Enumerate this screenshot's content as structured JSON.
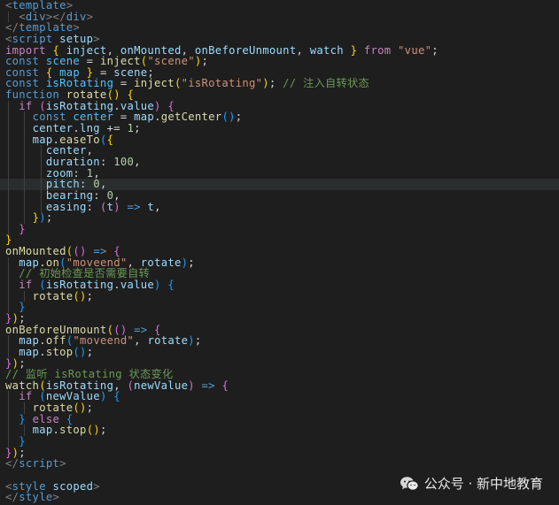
{
  "editor": {
    "background": "#1e1e1e",
    "lines": [
      {
        "indent": 0,
        "tokens": [
          [
            "br",
            "<"
          ],
          [
            "tag",
            "template"
          ],
          [
            "br",
            ">"
          ]
        ]
      },
      {
        "indent": 1,
        "tokens": [
          [
            "op",
            "  "
          ],
          [
            "br",
            "<"
          ],
          [
            "tag",
            "div"
          ],
          [
            "br",
            "></"
          ],
          [
            "tag",
            "div"
          ],
          [
            "br",
            ">"
          ]
        ]
      },
      {
        "indent": 0,
        "tokens": [
          [
            "br",
            "</"
          ],
          [
            "tag",
            "template"
          ],
          [
            "br",
            ">"
          ]
        ]
      },
      {
        "indent": 0,
        "tokens": [
          [
            "br",
            "<"
          ],
          [
            "tag",
            "script"
          ],
          [
            "op",
            " "
          ],
          [
            "attr",
            "setup"
          ],
          [
            "br",
            ">"
          ]
        ]
      },
      {
        "indent": 0,
        "tokens": [
          [
            "ctl",
            "import"
          ],
          [
            "op",
            " "
          ],
          [
            "p1",
            "{"
          ],
          [
            "op",
            " "
          ],
          [
            "prop",
            "inject"
          ],
          [
            "op",
            ", "
          ],
          [
            "prop",
            "onMounted"
          ],
          [
            "op",
            ", "
          ],
          [
            "prop",
            "onBeforeUnmount"
          ],
          [
            "op",
            ", "
          ],
          [
            "prop",
            "watch"
          ],
          [
            "op",
            " "
          ],
          [
            "p1",
            "}"
          ],
          [
            "op",
            " "
          ],
          [
            "ctl",
            "from"
          ],
          [
            "op",
            " "
          ],
          [
            "str",
            "\"vue\""
          ],
          [
            "op",
            ";"
          ]
        ]
      },
      {
        "indent": 0,
        "tokens": [
          [
            "kw",
            "const"
          ],
          [
            "op",
            " "
          ],
          [
            "var",
            "scene"
          ],
          [
            "op",
            " = "
          ],
          [
            "fn",
            "inject"
          ],
          [
            "p1",
            "("
          ],
          [
            "str",
            "\"scene\""
          ],
          [
            "p1",
            ")"
          ],
          [
            "op",
            ";"
          ]
        ]
      },
      {
        "indent": 0,
        "tokens": [
          [
            "kw",
            "const"
          ],
          [
            "op",
            " "
          ],
          [
            "p1",
            "{"
          ],
          [
            "op",
            " "
          ],
          [
            "var",
            "map"
          ],
          [
            "op",
            " "
          ],
          [
            "p1",
            "}"
          ],
          [
            "op",
            " = "
          ],
          [
            "prop",
            "scene"
          ],
          [
            "op",
            ";"
          ]
        ]
      },
      {
        "indent": 0,
        "tokens": [
          [
            "kw",
            "const"
          ],
          [
            "op",
            " "
          ],
          [
            "var",
            "isRotating"
          ],
          [
            "op",
            " = "
          ],
          [
            "fn",
            "inject"
          ],
          [
            "p1",
            "("
          ],
          [
            "str",
            "\"isRotating\""
          ],
          [
            "p1",
            ")"
          ],
          [
            "op",
            "; "
          ],
          [
            "cmt",
            "// 注入自转状态"
          ]
        ]
      },
      {
        "indent": 0,
        "tokens": [
          [
            "kw",
            "function"
          ],
          [
            "op",
            " "
          ],
          [
            "fn",
            "rotate"
          ],
          [
            "p1",
            "()"
          ],
          [
            "op",
            " "
          ],
          [
            "p1",
            "{"
          ]
        ]
      },
      {
        "indent": 1,
        "tokens": [
          [
            "op",
            "  "
          ],
          [
            "ctl",
            "if"
          ],
          [
            "op",
            " "
          ],
          [
            "p2",
            "("
          ],
          [
            "prop",
            "isRotating"
          ],
          [
            "op",
            "."
          ],
          [
            "prop",
            "value"
          ],
          [
            "p2",
            ")"
          ],
          [
            "op",
            " "
          ],
          [
            "p2",
            "{"
          ]
        ]
      },
      {
        "indent": 2,
        "tokens": [
          [
            "op",
            "    "
          ],
          [
            "kw",
            "const"
          ],
          [
            "op",
            " "
          ],
          [
            "var",
            "center"
          ],
          [
            "op",
            " = "
          ],
          [
            "prop",
            "map"
          ],
          [
            "op",
            "."
          ],
          [
            "fn",
            "getCenter"
          ],
          [
            "p3",
            "()"
          ],
          [
            "op",
            ";"
          ]
        ]
      },
      {
        "indent": 2,
        "tokens": [
          [
            "op",
            "    "
          ],
          [
            "prop",
            "center"
          ],
          [
            "op",
            "."
          ],
          [
            "prop",
            "lng"
          ],
          [
            "op",
            " += "
          ],
          [
            "num",
            "1"
          ],
          [
            "op",
            ";"
          ]
        ]
      },
      {
        "indent": 2,
        "tokens": [
          [
            "op",
            "    "
          ],
          [
            "prop",
            "map"
          ],
          [
            "op",
            "."
          ],
          [
            "fn",
            "easeTo"
          ],
          [
            "p3",
            "("
          ],
          [
            "p1",
            "{"
          ]
        ]
      },
      {
        "indent": 3,
        "tokens": [
          [
            "op",
            "      "
          ],
          [
            "prop",
            "center"
          ],
          [
            "op",
            ","
          ]
        ]
      },
      {
        "indent": 3,
        "tokens": [
          [
            "op",
            "      "
          ],
          [
            "prop",
            "duration"
          ],
          [
            "op",
            ": "
          ],
          [
            "num",
            "100"
          ],
          [
            "op",
            ","
          ]
        ]
      },
      {
        "indent": 3,
        "tokens": [
          [
            "op",
            "      "
          ],
          [
            "prop",
            "zoom"
          ],
          [
            "op",
            ": "
          ],
          [
            "num",
            "1"
          ],
          [
            "op",
            ","
          ]
        ]
      },
      {
        "indent": 3,
        "tokens": [
          [
            "op",
            "      "
          ],
          [
            "prop",
            "pitch"
          ],
          [
            "op",
            ": "
          ],
          [
            "num",
            "0"
          ],
          [
            "op",
            ","
          ]
        ],
        "highlight": true
      },
      {
        "indent": 3,
        "tokens": [
          [
            "op",
            "      "
          ],
          [
            "prop",
            "bearing"
          ],
          [
            "op",
            ": "
          ],
          [
            "num",
            "0"
          ],
          [
            "op",
            ","
          ]
        ]
      },
      {
        "indent": 3,
        "tokens": [
          [
            "op",
            "      "
          ],
          [
            "prop",
            "easing"
          ],
          [
            "op",
            ": "
          ],
          [
            "p2",
            "("
          ],
          [
            "prop",
            "t"
          ],
          [
            "p2",
            ")"
          ],
          [
            "op",
            " "
          ],
          [
            "kw",
            "=>"
          ],
          [
            "op",
            " "
          ],
          [
            "prop",
            "t"
          ],
          [
            "op",
            ","
          ]
        ]
      },
      {
        "indent": 2,
        "tokens": [
          [
            "op",
            "    "
          ],
          [
            "p1",
            "}"
          ],
          [
            "p3",
            ")"
          ],
          [
            "op",
            ";"
          ]
        ]
      },
      {
        "indent": 1,
        "tokens": [
          [
            "op",
            "  "
          ],
          [
            "p2",
            "}"
          ]
        ]
      },
      {
        "indent": 0,
        "tokens": [
          [
            "p1",
            "}"
          ]
        ]
      },
      {
        "indent": 0,
        "tokens": [
          [
            "fn",
            "onMounted"
          ],
          [
            "p1",
            "("
          ],
          [
            "p2",
            "()"
          ],
          [
            "op",
            " "
          ],
          [
            "kw",
            "=>"
          ],
          [
            "op",
            " "
          ],
          [
            "p2",
            "{"
          ]
        ]
      },
      {
        "indent": 1,
        "tokens": [
          [
            "op",
            "  "
          ],
          [
            "prop",
            "map"
          ],
          [
            "op",
            "."
          ],
          [
            "fn",
            "on"
          ],
          [
            "p3",
            "("
          ],
          [
            "str",
            "\"moveend\""
          ],
          [
            "op",
            ", "
          ],
          [
            "prop",
            "rotate"
          ],
          [
            "p3",
            ")"
          ],
          [
            "op",
            ";"
          ]
        ]
      },
      {
        "indent": 1,
        "tokens": [
          [
            "op",
            "  "
          ],
          [
            "cmt",
            "// 初始检查是否需要自转"
          ]
        ]
      },
      {
        "indent": 1,
        "tokens": [
          [
            "op",
            "  "
          ],
          [
            "ctl",
            "if"
          ],
          [
            "op",
            " "
          ],
          [
            "p3",
            "("
          ],
          [
            "prop",
            "isRotating"
          ],
          [
            "op",
            "."
          ],
          [
            "prop",
            "value"
          ],
          [
            "p3",
            ")"
          ],
          [
            "op",
            " "
          ],
          [
            "p3",
            "{"
          ]
        ]
      },
      {
        "indent": 2,
        "tokens": [
          [
            "op",
            "    "
          ],
          [
            "fn",
            "rotate"
          ],
          [
            "p1",
            "()"
          ],
          [
            "op",
            ";"
          ]
        ]
      },
      {
        "indent": 1,
        "tokens": [
          [
            "op",
            "  "
          ],
          [
            "p3",
            "}"
          ]
        ]
      },
      {
        "indent": 0,
        "tokens": [
          [
            "p2",
            "}"
          ],
          [
            "p1",
            ")"
          ],
          [
            "op",
            ";"
          ]
        ]
      },
      {
        "indent": 0,
        "tokens": [
          [
            "fn",
            "onBeforeUnmount"
          ],
          [
            "p1",
            "("
          ],
          [
            "p2",
            "()"
          ],
          [
            "op",
            " "
          ],
          [
            "kw",
            "=>"
          ],
          [
            "op",
            " "
          ],
          [
            "p2",
            "{"
          ]
        ]
      },
      {
        "indent": 1,
        "tokens": [
          [
            "op",
            "  "
          ],
          [
            "prop",
            "map"
          ],
          [
            "op",
            "."
          ],
          [
            "fn",
            "off"
          ],
          [
            "p3",
            "("
          ],
          [
            "str",
            "\"moveend\""
          ],
          [
            "op",
            ", "
          ],
          [
            "prop",
            "rotate"
          ],
          [
            "p3",
            ")"
          ],
          [
            "op",
            ";"
          ]
        ]
      },
      {
        "indent": 1,
        "tokens": [
          [
            "op",
            "  "
          ],
          [
            "prop",
            "map"
          ],
          [
            "op",
            "."
          ],
          [
            "fn",
            "stop"
          ],
          [
            "p3",
            "()"
          ],
          [
            "op",
            ";"
          ]
        ]
      },
      {
        "indent": 0,
        "tokens": [
          [
            "p2",
            "}"
          ],
          [
            "p1",
            ")"
          ],
          [
            "op",
            ";"
          ]
        ]
      },
      {
        "indent": 0,
        "tokens": [
          [
            "cmt",
            "// 监听 isRotating 状态变化"
          ]
        ]
      },
      {
        "indent": 0,
        "tokens": [
          [
            "fn",
            "watch"
          ],
          [
            "p1",
            "("
          ],
          [
            "prop",
            "isRotating"
          ],
          [
            "op",
            ", "
          ],
          [
            "p2",
            "("
          ],
          [
            "prop",
            "newValue"
          ],
          [
            "p2",
            ")"
          ],
          [
            "op",
            " "
          ],
          [
            "kw",
            "=>"
          ],
          [
            "op",
            " "
          ],
          [
            "p2",
            "{"
          ]
        ]
      },
      {
        "indent": 1,
        "tokens": [
          [
            "op",
            "  "
          ],
          [
            "ctl",
            "if"
          ],
          [
            "op",
            " "
          ],
          [
            "p3",
            "("
          ],
          [
            "prop",
            "newValue"
          ],
          [
            "p3",
            ")"
          ],
          [
            "op",
            " "
          ],
          [
            "p3",
            "{"
          ]
        ]
      },
      {
        "indent": 2,
        "tokens": [
          [
            "op",
            "    "
          ],
          [
            "fn",
            "rotate"
          ],
          [
            "p1",
            "()"
          ],
          [
            "op",
            ";"
          ]
        ]
      },
      {
        "indent": 1,
        "tokens": [
          [
            "op",
            "  "
          ],
          [
            "p3",
            "}"
          ],
          [
            "op",
            " "
          ],
          [
            "ctl",
            "else"
          ],
          [
            "op",
            " "
          ],
          [
            "p3",
            "{"
          ]
        ]
      },
      {
        "indent": 2,
        "tokens": [
          [
            "op",
            "    "
          ],
          [
            "prop",
            "map"
          ],
          [
            "op",
            "."
          ],
          [
            "fn",
            "stop"
          ],
          [
            "p1",
            "()"
          ],
          [
            "op",
            ";"
          ]
        ]
      },
      {
        "indent": 1,
        "tokens": [
          [
            "op",
            "  "
          ],
          [
            "p3",
            "}"
          ]
        ]
      },
      {
        "indent": 0,
        "tokens": [
          [
            "p2",
            "}"
          ],
          [
            "p1",
            ")"
          ],
          [
            "op",
            ";"
          ]
        ]
      },
      {
        "indent": 0,
        "tokens": [
          [
            "br",
            "</"
          ],
          [
            "tag",
            "script"
          ],
          [
            "br",
            ">"
          ]
        ]
      },
      {
        "indent": 0,
        "tokens": []
      },
      {
        "indent": 0,
        "tokens": [
          [
            "br",
            "<"
          ],
          [
            "tag",
            "style"
          ],
          [
            "op",
            " "
          ],
          [
            "attr",
            "scoped"
          ],
          [
            "br",
            ">"
          ]
        ]
      },
      {
        "indent": 0,
        "tokens": [
          [
            "br",
            "</"
          ],
          [
            "tag",
            "style"
          ],
          [
            "br",
            ">"
          ]
        ]
      }
    ]
  },
  "watermark": {
    "icon": "wechat-icon",
    "text": "公众号 · 新中地教育"
  }
}
